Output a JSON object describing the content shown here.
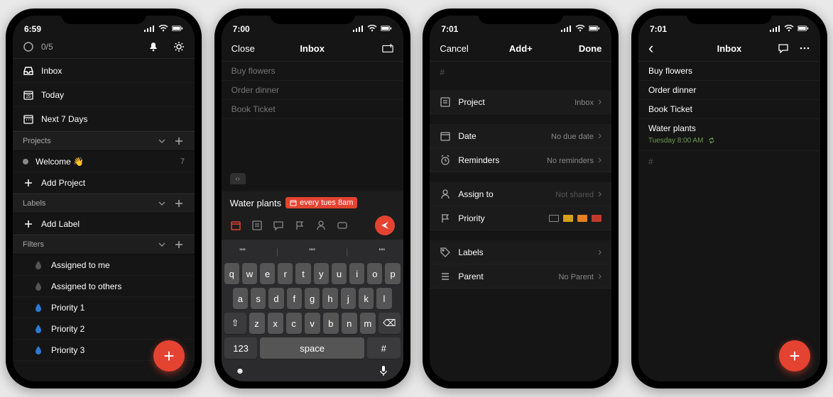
{
  "status": {
    "signal": "●●●●",
    "wifi": "wifi",
    "battery": "■■■"
  },
  "accent": "#e44332",
  "phones": [
    {
      "time": "6:59",
      "counter": "0/5",
      "nav": {
        "inbox": "Inbox",
        "today": "Today",
        "next7": "Next 7 Days"
      },
      "projects": {
        "title": "Projects",
        "welcome": "Welcome 👋",
        "welcome_count": "7",
        "add": "Add Project"
      },
      "labels": {
        "title": "Labels",
        "add": "Add Label"
      },
      "filters": {
        "title": "Filters",
        "items": [
          "Assigned to me",
          "Assigned to others",
          "Priority 1",
          "Priority 2",
          "Priority 3"
        ]
      }
    },
    {
      "time": "7:00",
      "header": {
        "left": "Close",
        "center": "Inbox"
      },
      "tasks": [
        "Buy flowers",
        "Order dinner",
        "Book Ticket"
      ],
      "quickadd": {
        "text": "Water plants",
        "chip": "every tues 8am"
      },
      "suggest": [
        "\"\"",
        "\"\"",
        "\"\""
      ],
      "keys": {
        "r1": [
          "q",
          "w",
          "e",
          "r",
          "t",
          "y",
          "u",
          "i",
          "o",
          "p"
        ],
        "r2": [
          "a",
          "s",
          "d",
          "f",
          "g",
          "h",
          "j",
          "k",
          "l"
        ],
        "r3_shift": "⇧",
        "r3": [
          "z",
          "x",
          "c",
          "v",
          "b",
          "n",
          "m"
        ],
        "r3_del": "⌫",
        "r4_123": "123",
        "r4_space": "space",
        "r4_hash": "#"
      }
    },
    {
      "time": "7:01",
      "header": {
        "left": "Cancel",
        "center": "Add+",
        "right": "Done"
      },
      "hash": "#",
      "rows": {
        "project": {
          "label": "Project",
          "value": "Inbox"
        },
        "date": {
          "label": "Date",
          "value": "No due date"
        },
        "reminders": {
          "label": "Reminders",
          "value": "No reminders"
        },
        "assign": {
          "label": "Assign to",
          "value": "Not shared"
        },
        "priority": {
          "label": "Priority"
        },
        "labels": {
          "label": "Labels"
        },
        "parent": {
          "label": "Parent",
          "value": "No Parent"
        }
      },
      "priority_colors": [
        "#888888",
        "#f5a623",
        "#f5a623",
        "#d0021b"
      ]
    },
    {
      "time": "7:01",
      "header": {
        "center": "Inbox"
      },
      "tasks": [
        "Buy flowers",
        "Order dinner",
        "Book Ticket"
      ],
      "new_task": {
        "title": "Water plants",
        "sub": "Tuesday 8:00 AM"
      },
      "hash": "#"
    }
  ]
}
